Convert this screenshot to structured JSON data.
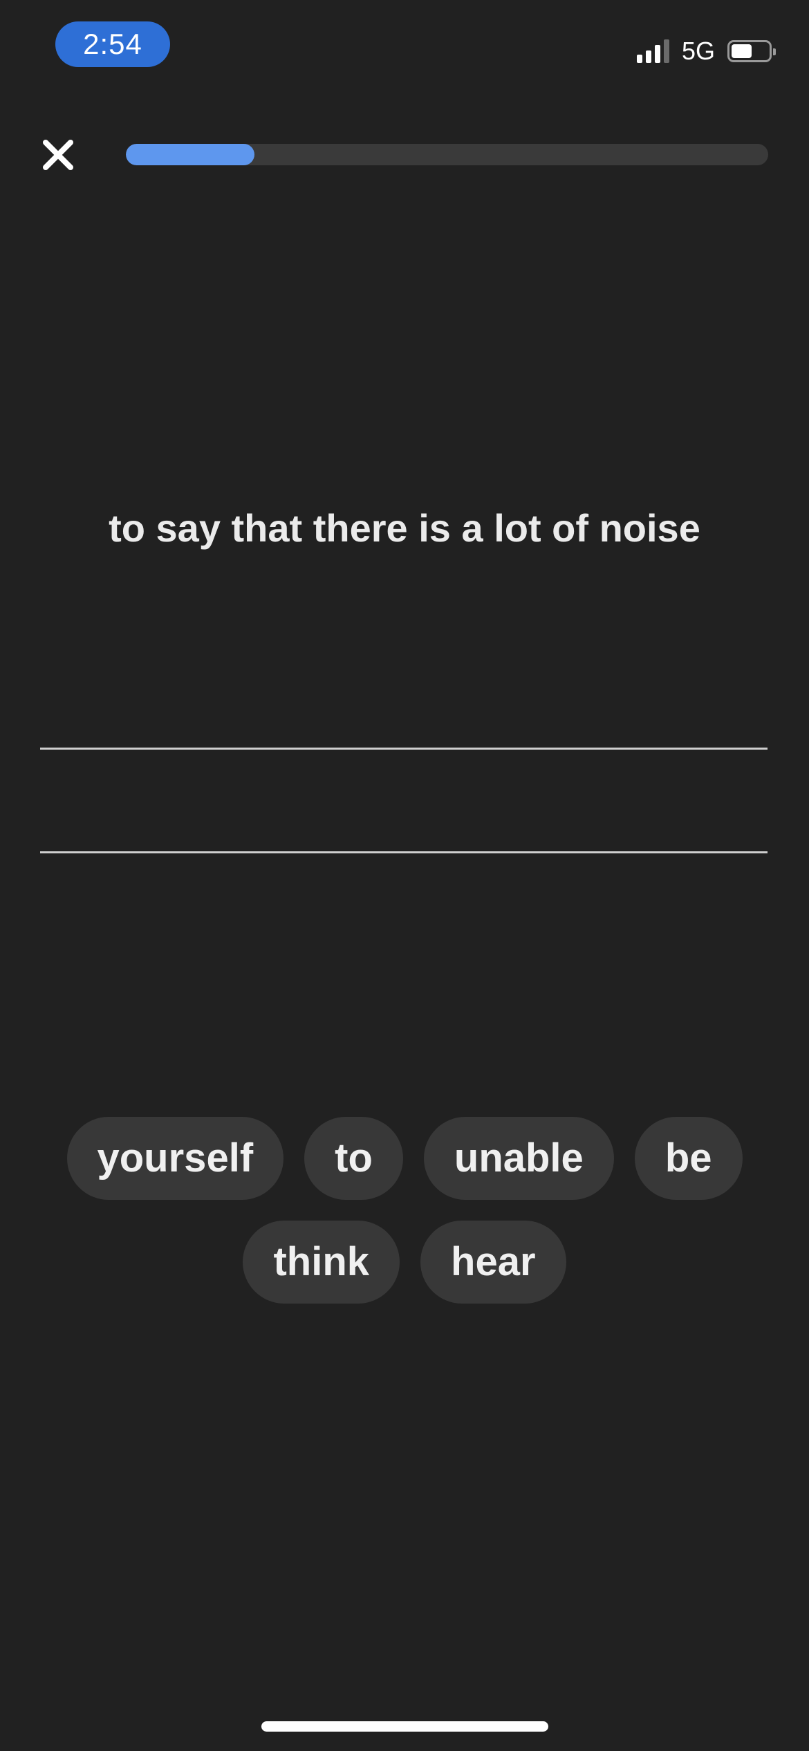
{
  "status_bar": {
    "time": "2:54",
    "network": "5G",
    "signal_bars_active": 3,
    "signal_bars_total": 4,
    "battery_level": 0.55,
    "time_pill_color": "#2e6fd6"
  },
  "top_bar": {
    "close_icon": "close-icon",
    "progress": 0.2,
    "progress_color": "#5e97ee"
  },
  "prompt": {
    "text": "to say that there is a lot of noise"
  },
  "word_bank": {
    "words": [
      "yourself",
      "to",
      "unable",
      "be",
      "think",
      "hear"
    ]
  }
}
